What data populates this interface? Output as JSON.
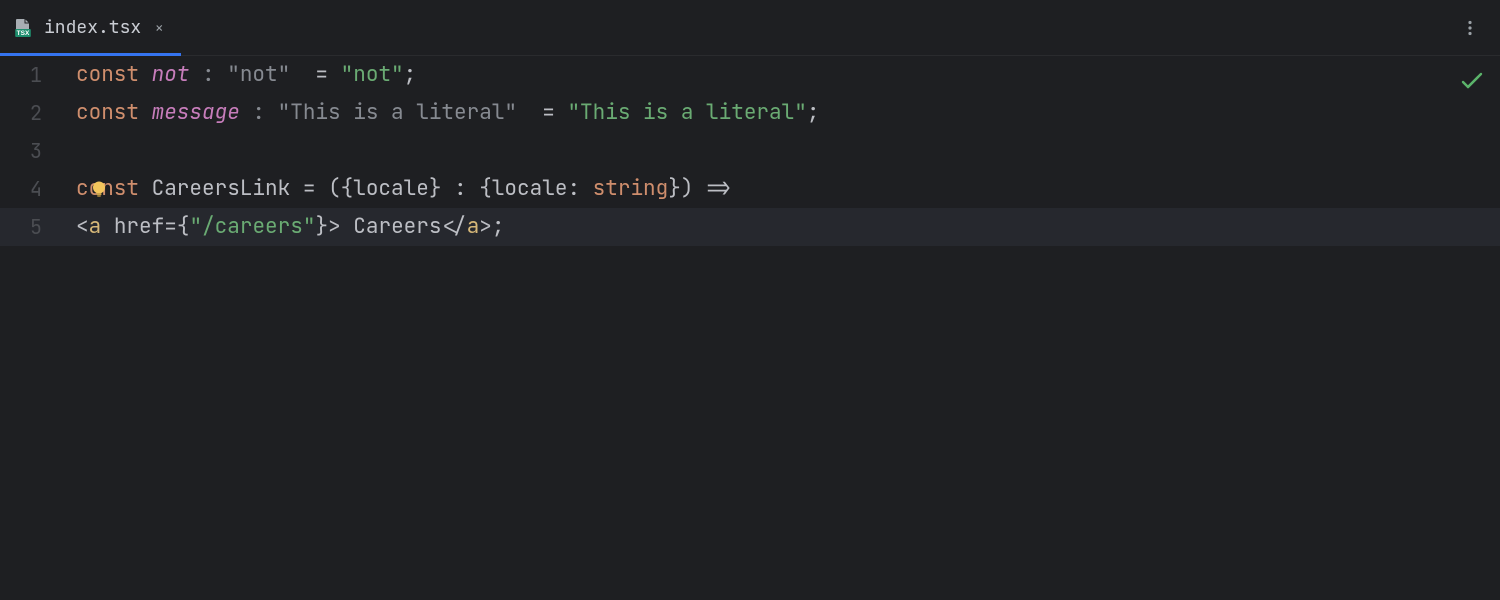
{
  "tab": {
    "filename": "index.tsx",
    "close_label": "×"
  },
  "status": {
    "ok_icon": "check"
  },
  "gutter": [
    "1",
    "2",
    "3",
    "4",
    "5"
  ],
  "code": {
    "l1": {
      "kw": "const",
      "name": "not",
      "ann_prefix": " : ",
      "ann": "\"not\"",
      "eq": "  = ",
      "val": "\"not\"",
      "semi": ";"
    },
    "l2": {
      "kw": "const",
      "name": "message",
      "ann_prefix": " : ",
      "ann": "\"This is a literal\"",
      "eq": "  = ",
      "val": "\"This is a literal\"",
      "semi": ";"
    },
    "l4": {
      "kw": "const",
      "name": "CareersLink",
      "rest1": " = ({",
      "locale1": "locale",
      "rest2": "} : {",
      "locale2": "locale",
      "colon": ": ",
      "type": "string",
      "rest3": "}) =>"
    },
    "l5": {
      "open": "<",
      "tag": "a",
      "sp": " ",
      "attr": "href",
      "eq": "=",
      "braceO": "{",
      "val": "\"/careers\"",
      "braceC": "}",
      "gt": ">",
      "text": " Careers",
      "closeO": "</",
      "closeTag": "a",
      "closeC": ">",
      "semi": ";"
    }
  },
  "hint": {
    "bulb": "lightbulb"
  }
}
